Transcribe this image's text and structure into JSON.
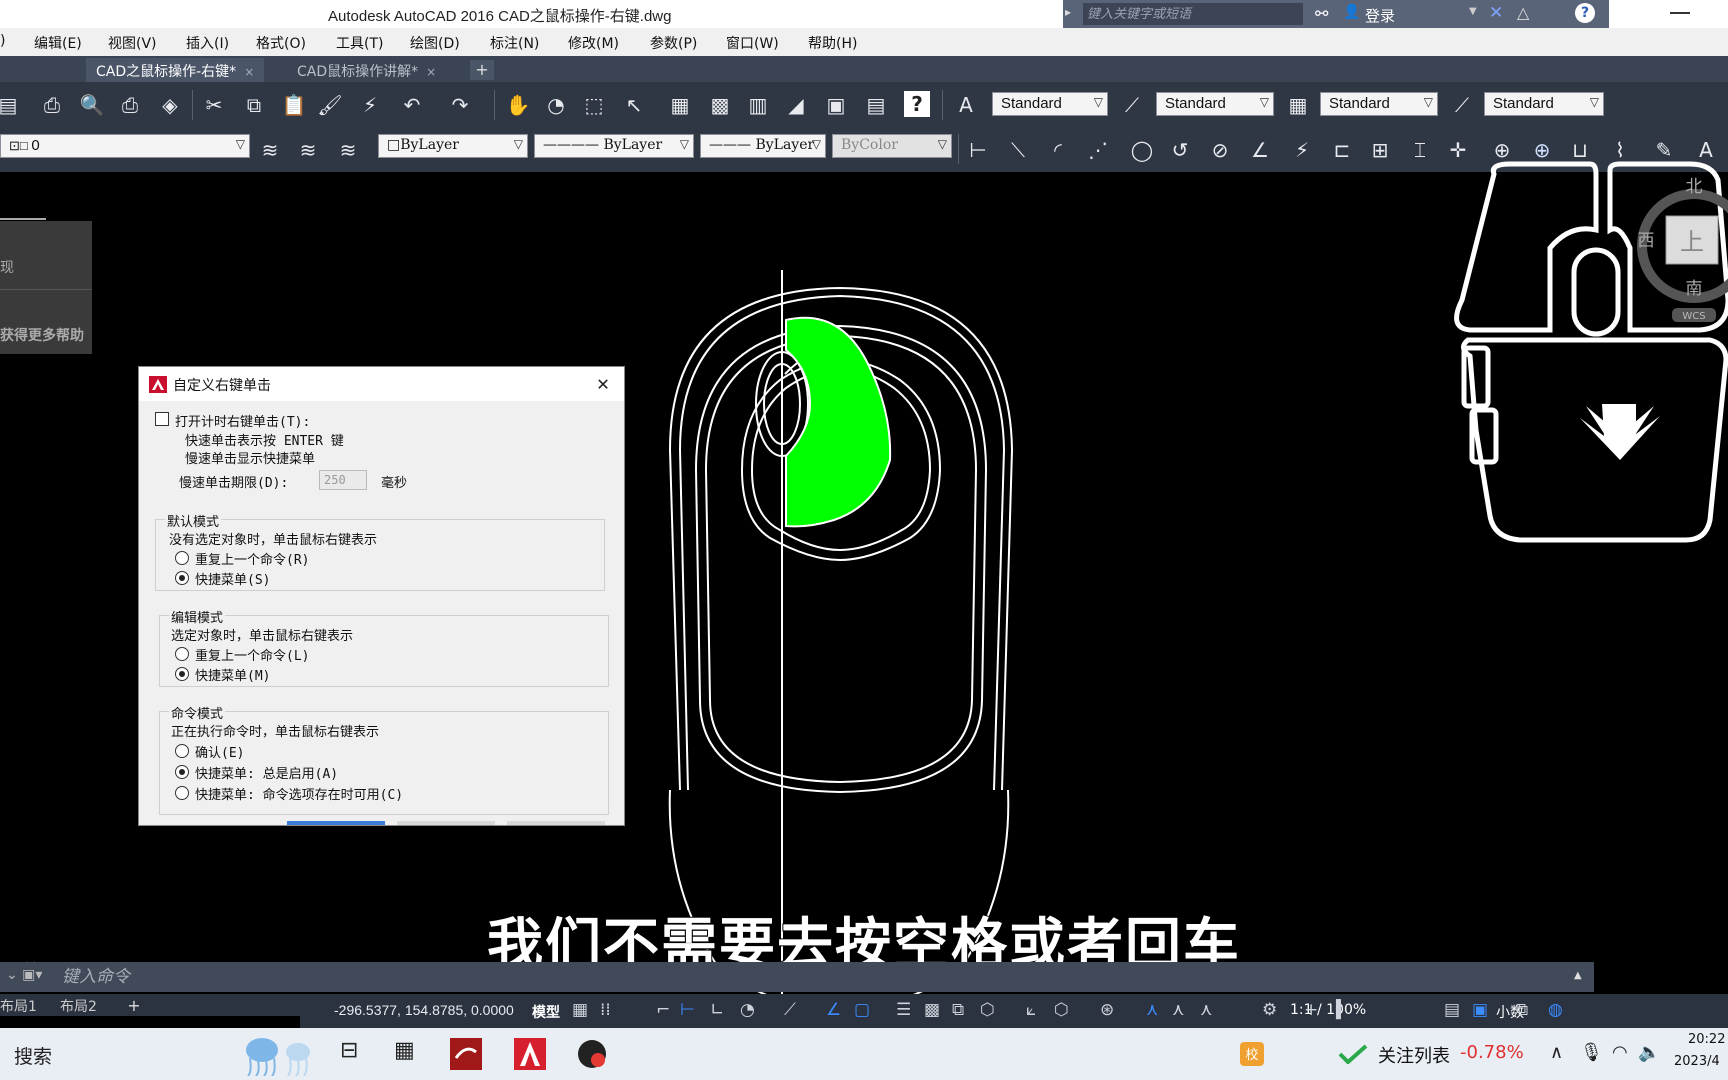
{
  "window": {
    "title": "Autodesk AutoCAD 2016    CAD之鼠标操作-右键.dwg"
  },
  "search": {
    "placeholder": "键入关键字或短语"
  },
  "account": {
    "login_label": "登录",
    "help_label": "?"
  },
  "menu": [
    {
      "label": ")"
    },
    {
      "label": "编辑(E)"
    },
    {
      "label": "视图(V)"
    },
    {
      "label": "插入(I)"
    },
    {
      "label": "格式(O)"
    },
    {
      "label": "工具(T)"
    },
    {
      "label": "绘图(D)"
    },
    {
      "label": "标注(N)"
    },
    {
      "label": "修改(M)"
    },
    {
      "label": "参数(P)"
    },
    {
      "label": "窗口(W)"
    },
    {
      "label": "帮助(H)"
    }
  ],
  "tabs": [
    {
      "label": "CAD之鼠标操作-右键*",
      "close": "×"
    },
    {
      "label": "CAD鼠标操作讲解*",
      "close": "×"
    }
  ],
  "tab_add": "+",
  "styles": {
    "text_style": "Standard",
    "dim_style": "Standard",
    "table_style": "Standard",
    "multileader_style": "Standard"
  },
  "properties": {
    "layer": "0",
    "color": "□ByLayer",
    "linetype": "———— ByLayer",
    "lineweight": "——— ByLayer",
    "plotstyle": "ByColor"
  },
  "left_panel": {
    "item1": "现",
    "item2": "获得更多帮助"
  },
  "dialog": {
    "title": "自定义右键单击",
    "close": "✕",
    "timed_checkbox_label": "打开计时右键单击(T):",
    "timed_checked": false,
    "hint1": "快速单击表示按 ENTER 键",
    "hint2": "慢速单击显示快捷菜单",
    "duration_label": "慢速单击期限(D):",
    "duration_value": "250",
    "duration_unit": "毫秒",
    "default_mode": {
      "title": "默认模式",
      "desc": "没有选定对象时，单击鼠标右键表示",
      "opt1": "重复上一个命令(R)",
      "opt2": "快捷菜单(S)",
      "selected": 2
    },
    "edit_mode": {
      "title": "编辑模式",
      "desc": "选定对象时，单击鼠标右键表示",
      "opt1": "重复上一个命令(L)",
      "opt2": "快捷菜单(M)",
      "selected": 2
    },
    "command_mode": {
      "title": "命令模式",
      "desc": "正在执行命令时，单击鼠标右键表示",
      "opt1": "确认(E)",
      "opt2": "快捷菜单: 总是启用(A)",
      "opt3": "快捷菜单: 命令选项存在时可用(C)",
      "selected": 2
    }
  },
  "viewcube": {
    "north": "北",
    "west": "西",
    "top": "上",
    "south": "南",
    "wcs": "WCS"
  },
  "caption": "我们不需要去按空格或者回车",
  "command": {
    "placeholder": "键入命令"
  },
  "layout_tabs": [
    {
      "label": "布局1"
    },
    {
      "label": "布局2"
    }
  ],
  "layout_add": "+",
  "status": {
    "coords": "-296.5377, 154.8785, 0.0000",
    "model": "模型",
    "scale": "1:1 / 100%",
    "units": "小数"
  },
  "taskbar": {
    "search_label": "搜索",
    "stock_name": "关注列表",
    "stock_value": "-0.78%",
    "time": "20:22",
    "date": "2023/4"
  },
  "colors": {
    "canvas": "#000000",
    "highlight": "#00ff00",
    "toolbar": "#2f3744",
    "tab_bar": "#3b4453",
    "stock_negative": "#e03030"
  }
}
